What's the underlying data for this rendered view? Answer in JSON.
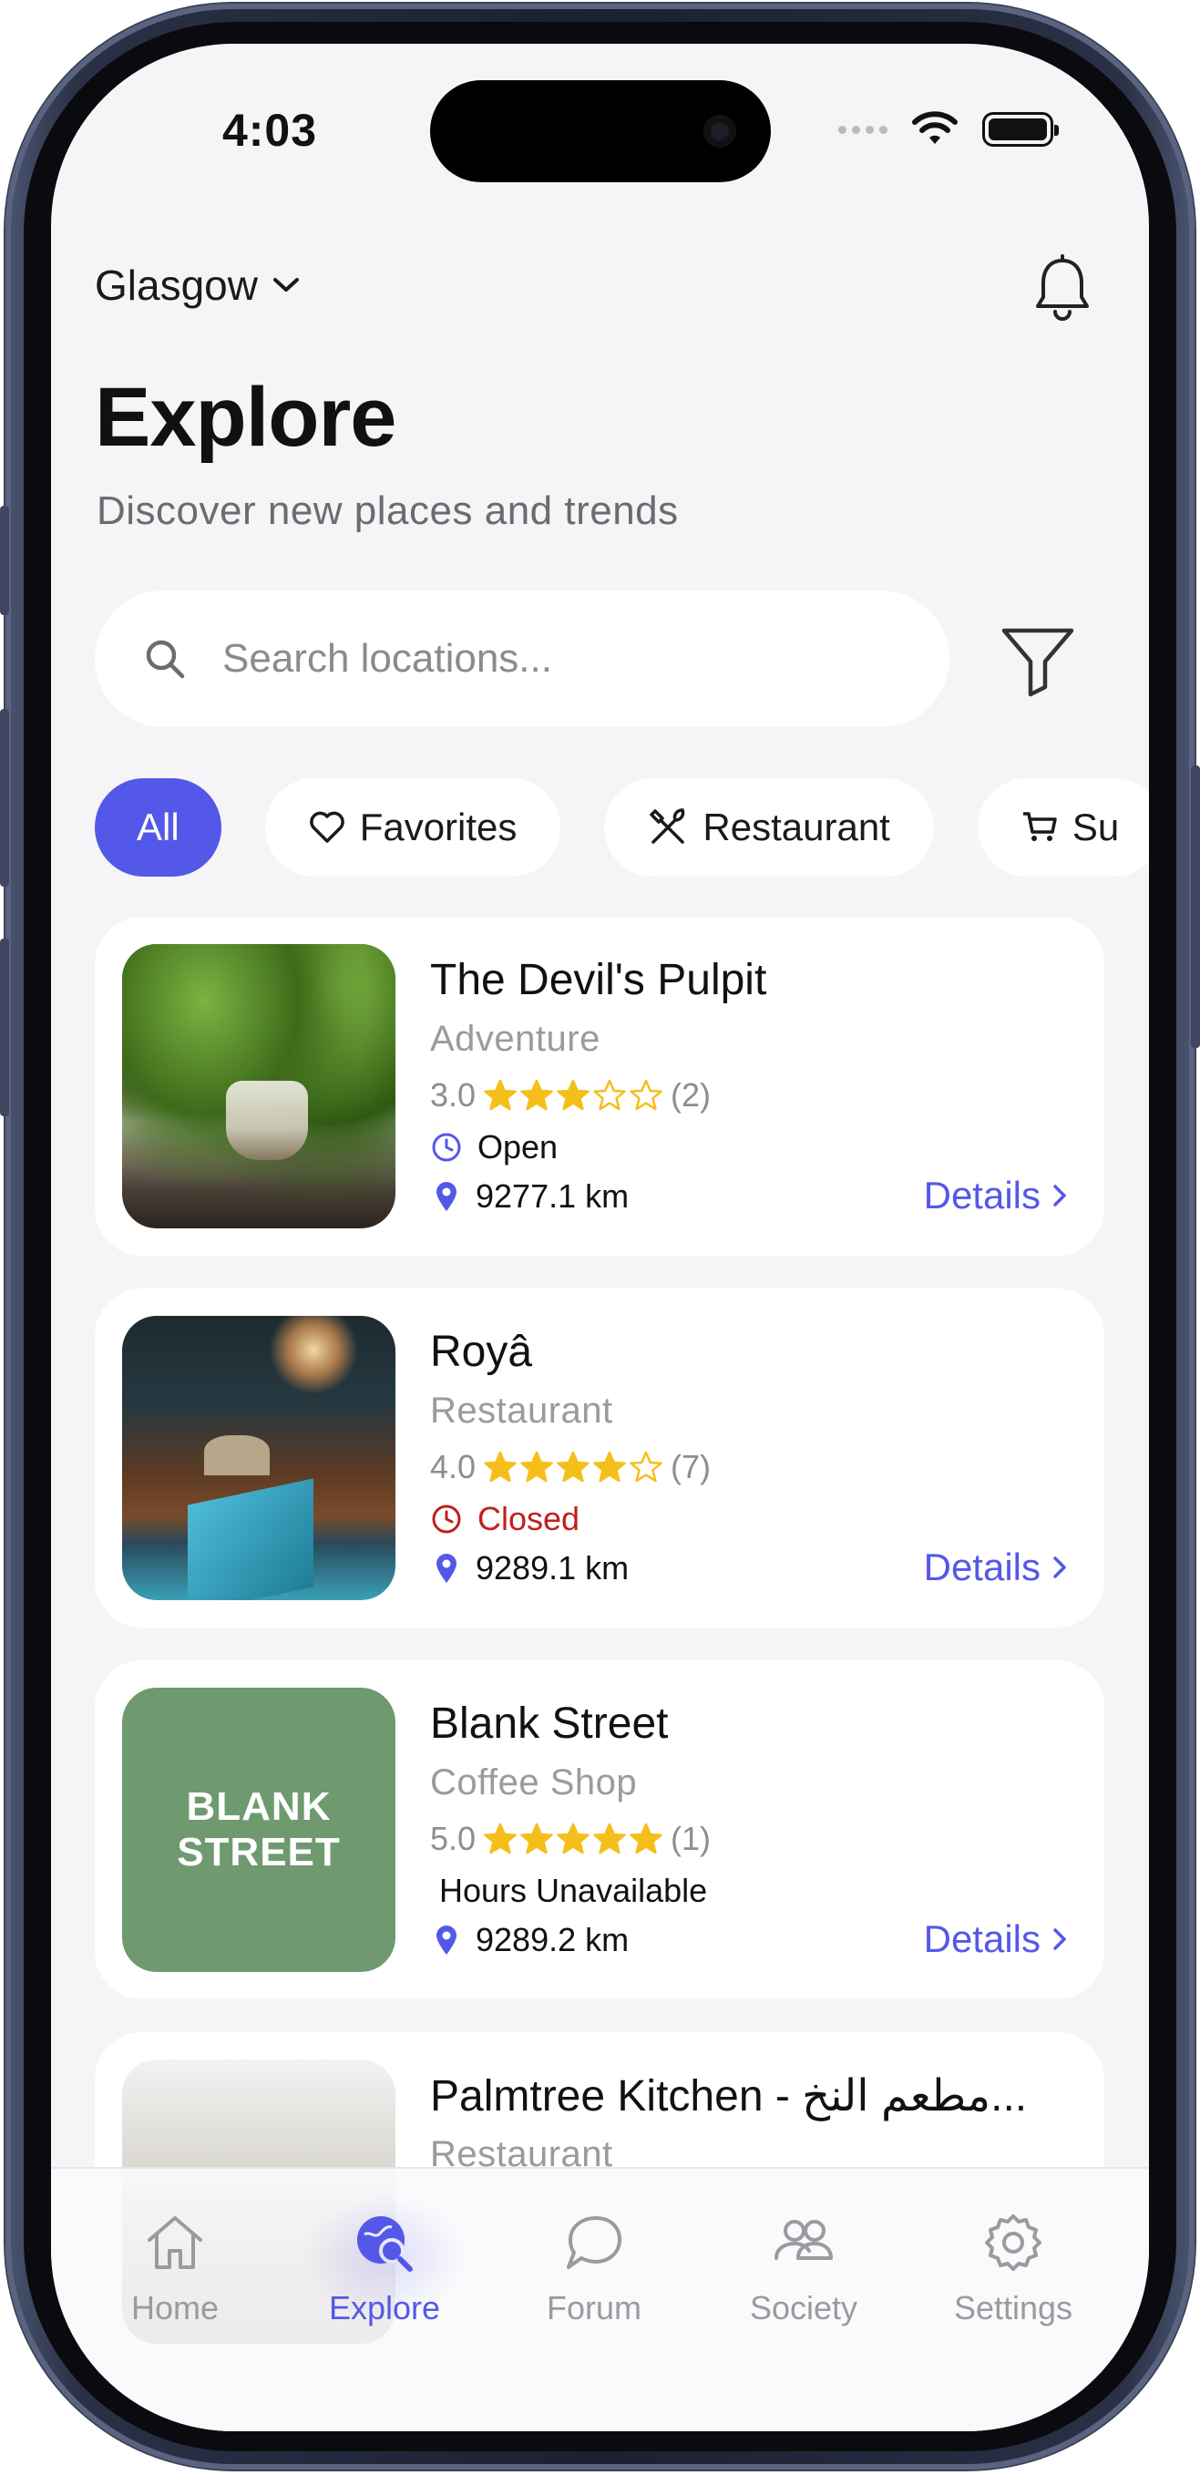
{
  "status_bar": {
    "time": "4:03"
  },
  "header": {
    "city": "Glasgow",
    "title": "Explore",
    "subtitle": "Discover new places and trends"
  },
  "search": {
    "placeholder": "Search locations..."
  },
  "chips": [
    {
      "label": "All",
      "active": true
    },
    {
      "label": "Favorites",
      "icon": "heart-icon"
    },
    {
      "label": "Restaurant",
      "icon": "utensils-icon"
    },
    {
      "label": "Su",
      "icon": "cart-icon"
    }
  ],
  "places": [
    {
      "name": "The Devil's Pulpit",
      "category": "Adventure",
      "rating": "3.0",
      "stars": 3,
      "reviews": "(2)",
      "hours": "Open",
      "hours_state": "open",
      "distance": "9277.1 km",
      "details": "Details"
    },
    {
      "name": "Royâ",
      "category": "Restaurant",
      "rating": "4.0",
      "stars": 4,
      "reviews": "(7)",
      "hours": "Closed",
      "hours_state": "closed",
      "distance": "9289.1 km",
      "details": "Details"
    },
    {
      "name": "Blank Street",
      "category": "Coffee Shop",
      "rating": "5.0",
      "stars": 5,
      "reviews": "(1)",
      "hours": "Hours Unavailable",
      "hours_state": "unavailable",
      "distance": "9289.2 km",
      "details": "Details",
      "thumb_text": "BLANK STREET"
    },
    {
      "name": "Palmtree Kitchen - مطعم النخ...",
      "category": "Restaurant"
    }
  ],
  "tabbar": [
    {
      "label": "Home",
      "icon": "home-icon"
    },
    {
      "label": "Explore",
      "icon": "explore-icon",
      "active": true
    },
    {
      "label": "Forum",
      "icon": "chat-bubble-icon"
    },
    {
      "label": "Society",
      "icon": "people-icon"
    },
    {
      "label": "Settings",
      "icon": "gear-icon"
    }
  ],
  "colors": {
    "accent": "#5458e8",
    "star": "#f5bf1b",
    "closed": "#c0201d",
    "background": "#f5f5f7"
  }
}
